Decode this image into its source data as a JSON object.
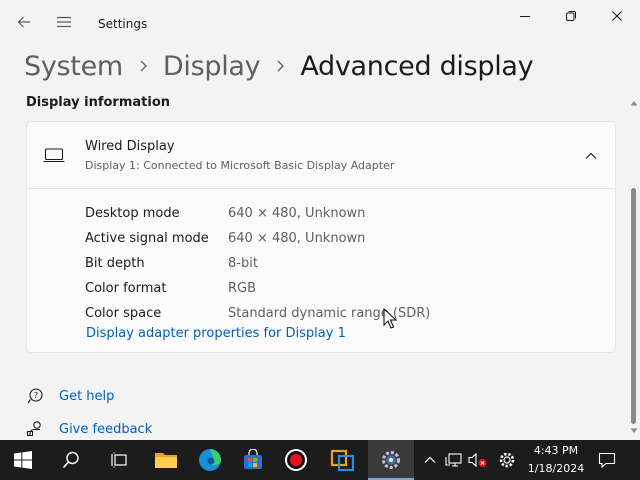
{
  "window": {
    "app_title": "Settings",
    "back_icon": "back-arrow-icon",
    "menu_icon": "hamburger-menu-icon"
  },
  "breadcrumb": {
    "items": [
      "System",
      "Display",
      "Advanced display"
    ]
  },
  "section": {
    "title": "Display information"
  },
  "display_card": {
    "title": "Wired Display",
    "subtitle": "Display 1: Connected to Microsoft Basic Display Adapter",
    "expanded": true,
    "rows": [
      {
        "label": "Desktop mode",
        "value": "640 × 480, Unknown"
      },
      {
        "label": "Active signal mode",
        "value": "640 × 480, Unknown"
      },
      {
        "label": "Bit depth",
        "value": "8-bit"
      },
      {
        "label": "Color format",
        "value": "RGB"
      },
      {
        "label": "Color space",
        "value": "Standard dynamic range (SDR)"
      }
    ],
    "link": "Display adapter properties for Display 1"
  },
  "help": {
    "get_help": "Get help",
    "give_feedback": "Give feedback"
  },
  "taskbar": {
    "apps": [
      "start",
      "search",
      "task-view",
      "file-explorer",
      "edge",
      "store",
      "recorder",
      "virtualbox",
      "settings"
    ],
    "active_app": "settings",
    "time": "4:43 PM",
    "date": "1/18/2024"
  },
  "colors": {
    "accent": "#005fb8",
    "background": "#f3f3f3",
    "card": "#fbfbfb",
    "taskbar": "#1c1c1c"
  }
}
